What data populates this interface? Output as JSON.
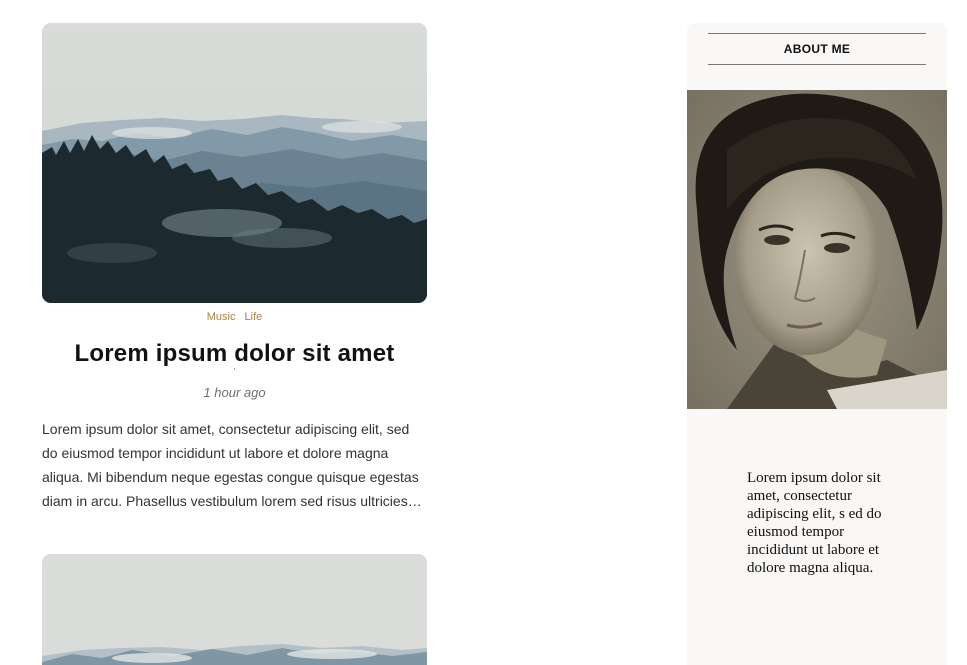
{
  "posts": [
    {
      "image_icon": "landscape-mountains-forest-photo",
      "tags": [
        "Music",
        "Life"
      ],
      "title": "Lorem ipsum dolor sit amet",
      "title_mark": "'",
      "time": "1 hour ago",
      "excerpt": "Lorem ipsum dolor sit amet, consectetur adipiscing elit, sed do eiusmod tempor incididunt ut labore et dolore magna aliqua. Mi bibendum neque egestas congue quisque egestas diam in arcu. Phasellus vestibulum lorem sed risus ultricies tristique nulla aliquet enim."
    },
    {
      "image_icon": "landscape-mountains-photo"
    }
  ],
  "sidebar": {
    "about_title": "ABOUT ME",
    "photo_icon": "vintage-portrait-photo",
    "about_text": "Lorem ipsum dolor sit amet, consectetur adipiscing elit, s ed do eiusmod tempor incididunt ut labore et dolore magna aliqua."
  },
  "colors": {
    "tag": "#a8843e",
    "sidebar_bg": "#faf8f6",
    "title": "#111111"
  }
}
